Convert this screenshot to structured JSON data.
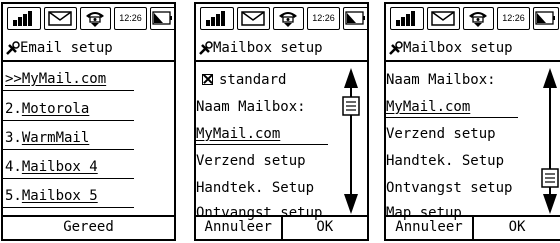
{
  "status": {
    "time": "12:26"
  },
  "screens": [
    {
      "title": "Email setup",
      "items": [
        ">>MyMail.com",
        "2.Motorola",
        "3.WarmMail",
        "4.Mailbox 4",
        "5.Mailbox 5"
      ],
      "softkeys": [
        "Gereed"
      ]
    },
    {
      "title": "Mailbox setup",
      "check_label": "standard",
      "items": [
        "Naam Mailbox:",
        "MyMail.com",
        "Verzend setup",
        "Handtek. Setup",
        "Ontvangst setup"
      ],
      "softkeys": [
        "Annuleer",
        "OK"
      ],
      "scroll_position": 0.1
    },
    {
      "title": "Mailbox setup",
      "items": [
        "Naam Mailbox:",
        "MyMail.com",
        "Verzend setup",
        "Handtek. Setup",
        "Ontvangst setup",
        "Map setup"
      ],
      "softkeys": [
        "Annuleer",
        "OK"
      ],
      "scroll_position": 0.9
    }
  ],
  "icons": [
    "signal-icon",
    "envelope-icon",
    "phone-icon",
    "battery-icon",
    "wrench-icon",
    "checkbox-icon",
    "scroll-up-icon",
    "scroll-down-icon",
    "scroll-thumb-icon"
  ]
}
